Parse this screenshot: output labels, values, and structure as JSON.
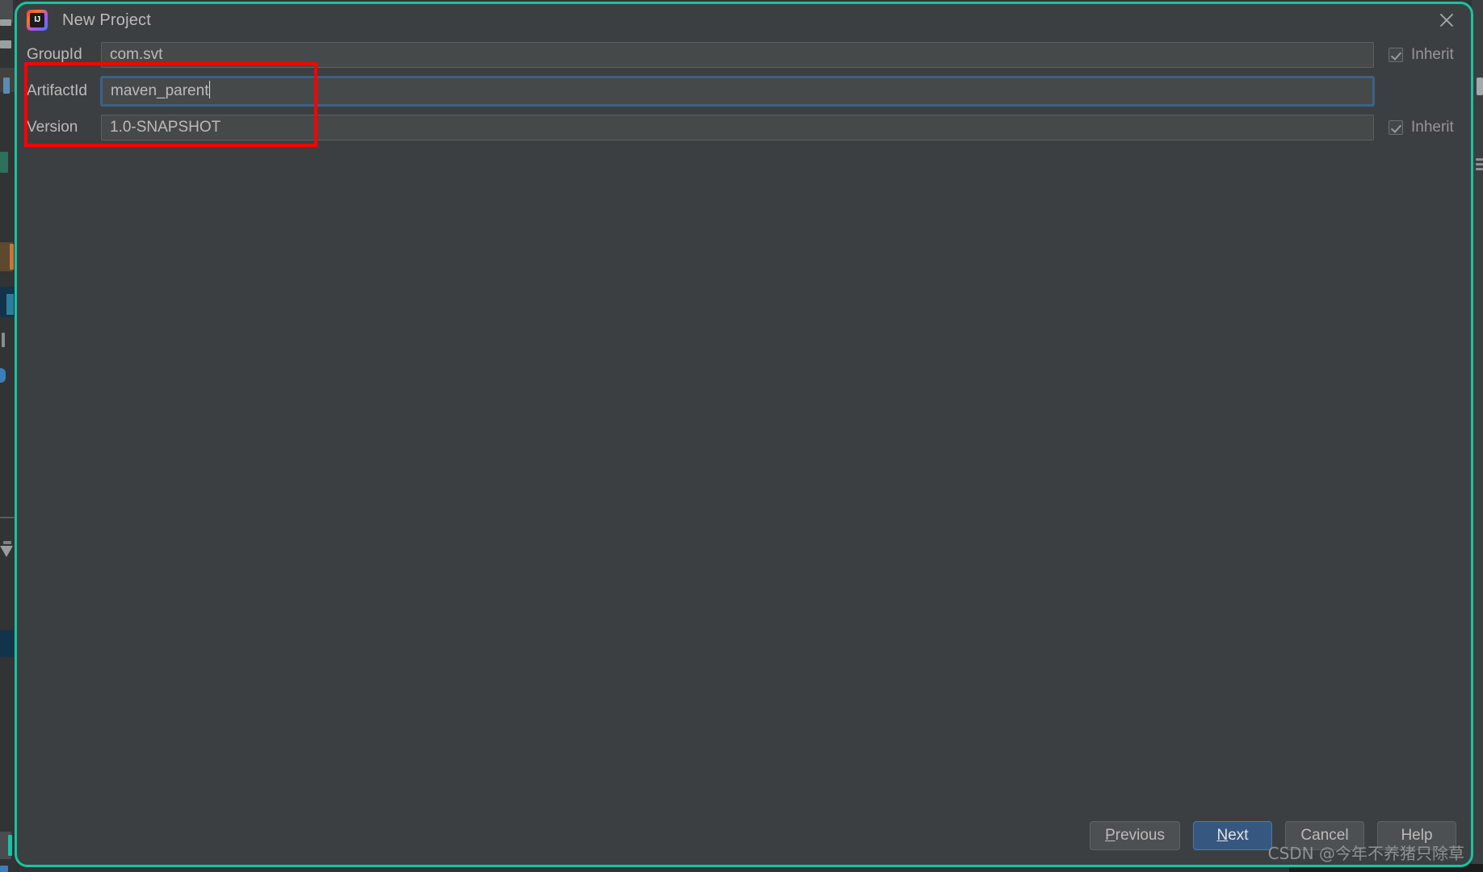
{
  "dialog": {
    "title": "New Project",
    "app_icon": "intellij-idea-icon",
    "close_icon": "close-icon",
    "border_color": "#17c4a0"
  },
  "form": {
    "rows": [
      {
        "label": "GroupId",
        "value": "com.svt",
        "focused": false,
        "inherit_label": "Inherit",
        "inherit_checked": true,
        "has_inherit": true
      },
      {
        "label": "ArtifactId",
        "value": "maven_parent",
        "focused": true,
        "inherit_label": "",
        "inherit_checked": false,
        "has_inherit": false
      },
      {
        "label": "Version",
        "value": "1.0-SNAPSHOT",
        "focused": false,
        "inherit_label": "Inherit",
        "inherit_checked": true,
        "has_inherit": true
      }
    ]
  },
  "annotation": {
    "color": "#fe0000",
    "shape": "rectangle-highlight"
  },
  "footer": {
    "buttons": [
      {
        "label": "Previous",
        "mnemonic": "P",
        "primary": false
      },
      {
        "label": "Next",
        "mnemonic": "N",
        "primary": true
      },
      {
        "label": "Cancel",
        "mnemonic": "",
        "primary": false
      },
      {
        "label": "Help",
        "mnemonic": "",
        "primary": false
      }
    ]
  },
  "watermark": {
    "text": "CSDN @今年不养猪只除草"
  }
}
